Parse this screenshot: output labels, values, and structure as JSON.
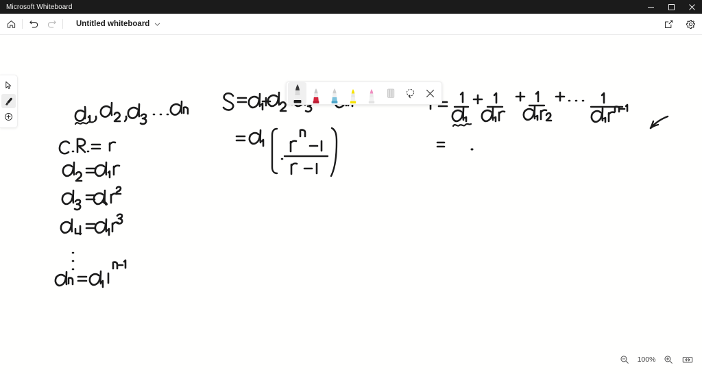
{
  "window": {
    "app_title": "Microsoft Whiteboard",
    "controls": {
      "minimize": "minimize-icon",
      "maximize": "maximize-icon",
      "close": "close-icon"
    }
  },
  "commandbar": {
    "home_icon": "home-icon",
    "undo_icon": "undo-icon",
    "redo_icon": "redo-icon",
    "document_title": "Untitled whiteboard",
    "title_chevron_icon": "chevron-down-icon",
    "share_icon": "share-icon",
    "settings_icon": "gear-icon"
  },
  "rail": {
    "items": [
      {
        "name": "select-tool",
        "icon": "cursor-icon",
        "selected": false
      },
      {
        "name": "pen-tool",
        "icon": "pen-icon",
        "selected": true
      },
      {
        "name": "insert-tool",
        "icon": "plus-circle-icon",
        "selected": false
      }
    ]
  },
  "pen_toolbar": {
    "pens": [
      {
        "label": "Black pen",
        "color": "#1a1a1a",
        "selected": true
      },
      {
        "label": "Red pen",
        "color": "#d6243c",
        "selected": false
      },
      {
        "label": "Blue pen",
        "color": "#4aa3c7",
        "selected": false
      },
      {
        "label": "Yellow highlighter",
        "color": "#f6e200",
        "selected": false
      },
      {
        "label": "Pink highlighter",
        "color": "#ef8ec0",
        "selected": false
      }
    ],
    "eraser": {
      "label": "Eraser",
      "icon": "eraser-icon"
    },
    "lasso": {
      "label": "Lasso select",
      "icon": "lasso-icon"
    },
    "close": {
      "label": "Close ink toolbar",
      "icon": "close-icon"
    }
  },
  "zoom": {
    "zoom_out_icon": "zoom-out-icon",
    "level": "100%",
    "zoom_in_icon": "zoom-in-icon",
    "fit_icon": "fit-to-screen-icon"
  },
  "canvas": {
    "ink_notes": {
      "column_left": [
        "a1 , a2 , a3 . . . an",
        "C.R. = r",
        "a2 = a1 r",
        "a3 = a1 r^2",
        "a4 = a1 r^3",
        ":",
        "an = a1 r^(n-1)"
      ],
      "column_middle": [
        "S = a1 + a2 + a3 + . . . an",
        "= a1 [ ( r^n - 1 ) / ( r - 1 ) ]"
      ],
      "column_right": [
        "T = 1/a1 + 1/(a1 r) + 1/(a1 r^2) + . . . 1/(a1 r^(n-1))",
        "="
      ],
      "marks": [
        "squiggle-underline-under-a1",
        "squiggle-underline-under-1-over-a1",
        "arrow-stroke-top-right"
      ]
    }
  }
}
